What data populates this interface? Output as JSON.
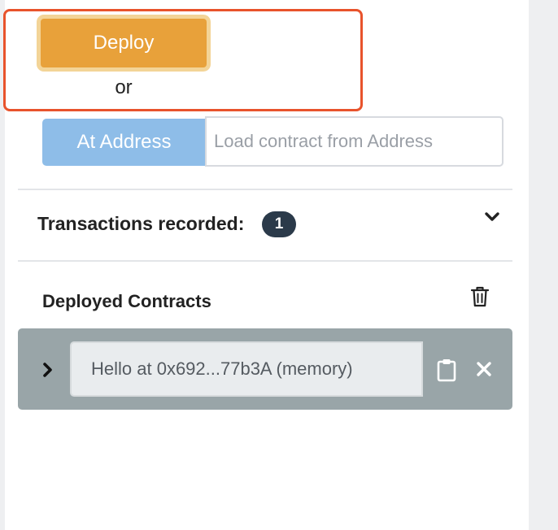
{
  "deploy": {
    "button_label": "Deploy",
    "or_label": "or"
  },
  "at_address": {
    "button_label": "At Address",
    "input_placeholder": "Load contract from Address",
    "input_value": ""
  },
  "transactions": {
    "label": "Transactions recorded:",
    "count": "1",
    "toggle_icon": "chevron-down-icon"
  },
  "deployed_contracts": {
    "title": "Deployed Contracts",
    "clear_icon": "trash-icon",
    "items": [
      {
        "label": "Hello at 0x692...77b3A (memory)",
        "expand_icon": "chevron-right-icon",
        "copy_icon": "clipboard-icon",
        "remove_icon": "close-icon"
      }
    ]
  },
  "colors": {
    "deploy_bg": "#e8a13a",
    "deploy_border": "#f3d497",
    "highlight_border": "#e8532c",
    "at_address_bg": "#8ebde8",
    "badge_bg": "#2b3a4a",
    "contract_row_bg": "#99a5a8"
  }
}
